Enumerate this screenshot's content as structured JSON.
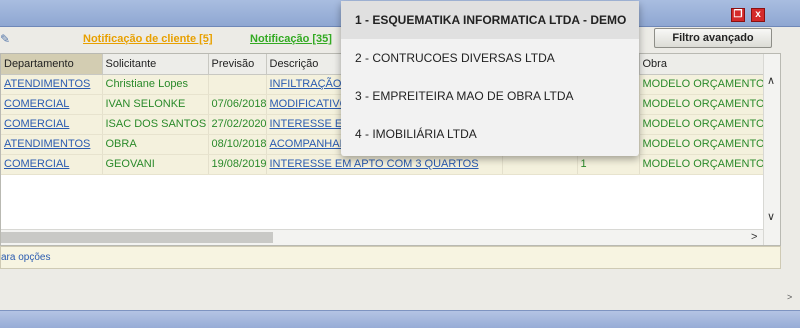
{
  "window": {
    "restore_glyph": "❐",
    "close_glyph": "x"
  },
  "toolbar": {
    "client_notifications": "Notificação de cliente [5]",
    "notifications": "Notificação [35]",
    "advanced_filter": "Filtro avançado"
  },
  "grid": {
    "columns": [
      "Departamento",
      "Solicitante",
      "Previsão",
      "Descrição",
      "",
      "",
      "Obra"
    ],
    "rows": [
      {
        "dept": "ATENDIMENTOS",
        "requester": "Christiane Lopes",
        "due": "",
        "desc": "INFILTRAÇÃO",
        "c5": "",
        "c6": "",
        "work": "MODELO ORÇAMENTO"
      },
      {
        "dept": "COMERCIAL",
        "requester": "IVAN SELONKE",
        "due": "07/06/2018",
        "desc": "MODIFICATIVO",
        "c5": "",
        "c6": "",
        "work": "MODELO ORÇAMENTO"
      },
      {
        "dept": "COMERCIAL",
        "requester": "ISAC DOS SANTOS",
        "due": "27/02/2020",
        "desc": "INTERESSE EM",
        "c5": "",
        "c6": "",
        "work": "MODELO ORÇAMENTO"
      },
      {
        "dept": "ATENDIMENTOS",
        "requester": "OBRA",
        "due": "08/10/2018",
        "desc": "ACOMPANHAM",
        "c5": "",
        "c6": "",
        "work": "MODELO ORÇAMENTO"
      },
      {
        "dept": "COMERCIAL",
        "requester": "GEOVANI",
        "due": "19/08/2019",
        "desc": "INTERESSE EM APTO COM 3 QUARTOS",
        "c5": "",
        "c6": "1",
        "work": "MODELO ORÇAMENTO"
      }
    ]
  },
  "footer": {
    "text": "ara opções"
  },
  "dropdown": {
    "items": [
      "1 - ESQUEMATIKA INFORMATICA LTDA - DEMO",
      "2 - CONTRUCOES DIVERSAS LTDA",
      "3 - EMPREITEIRA MAO DE OBRA LTDA",
      "4 - IMOBILIÁRIA LTDA"
    ]
  }
}
